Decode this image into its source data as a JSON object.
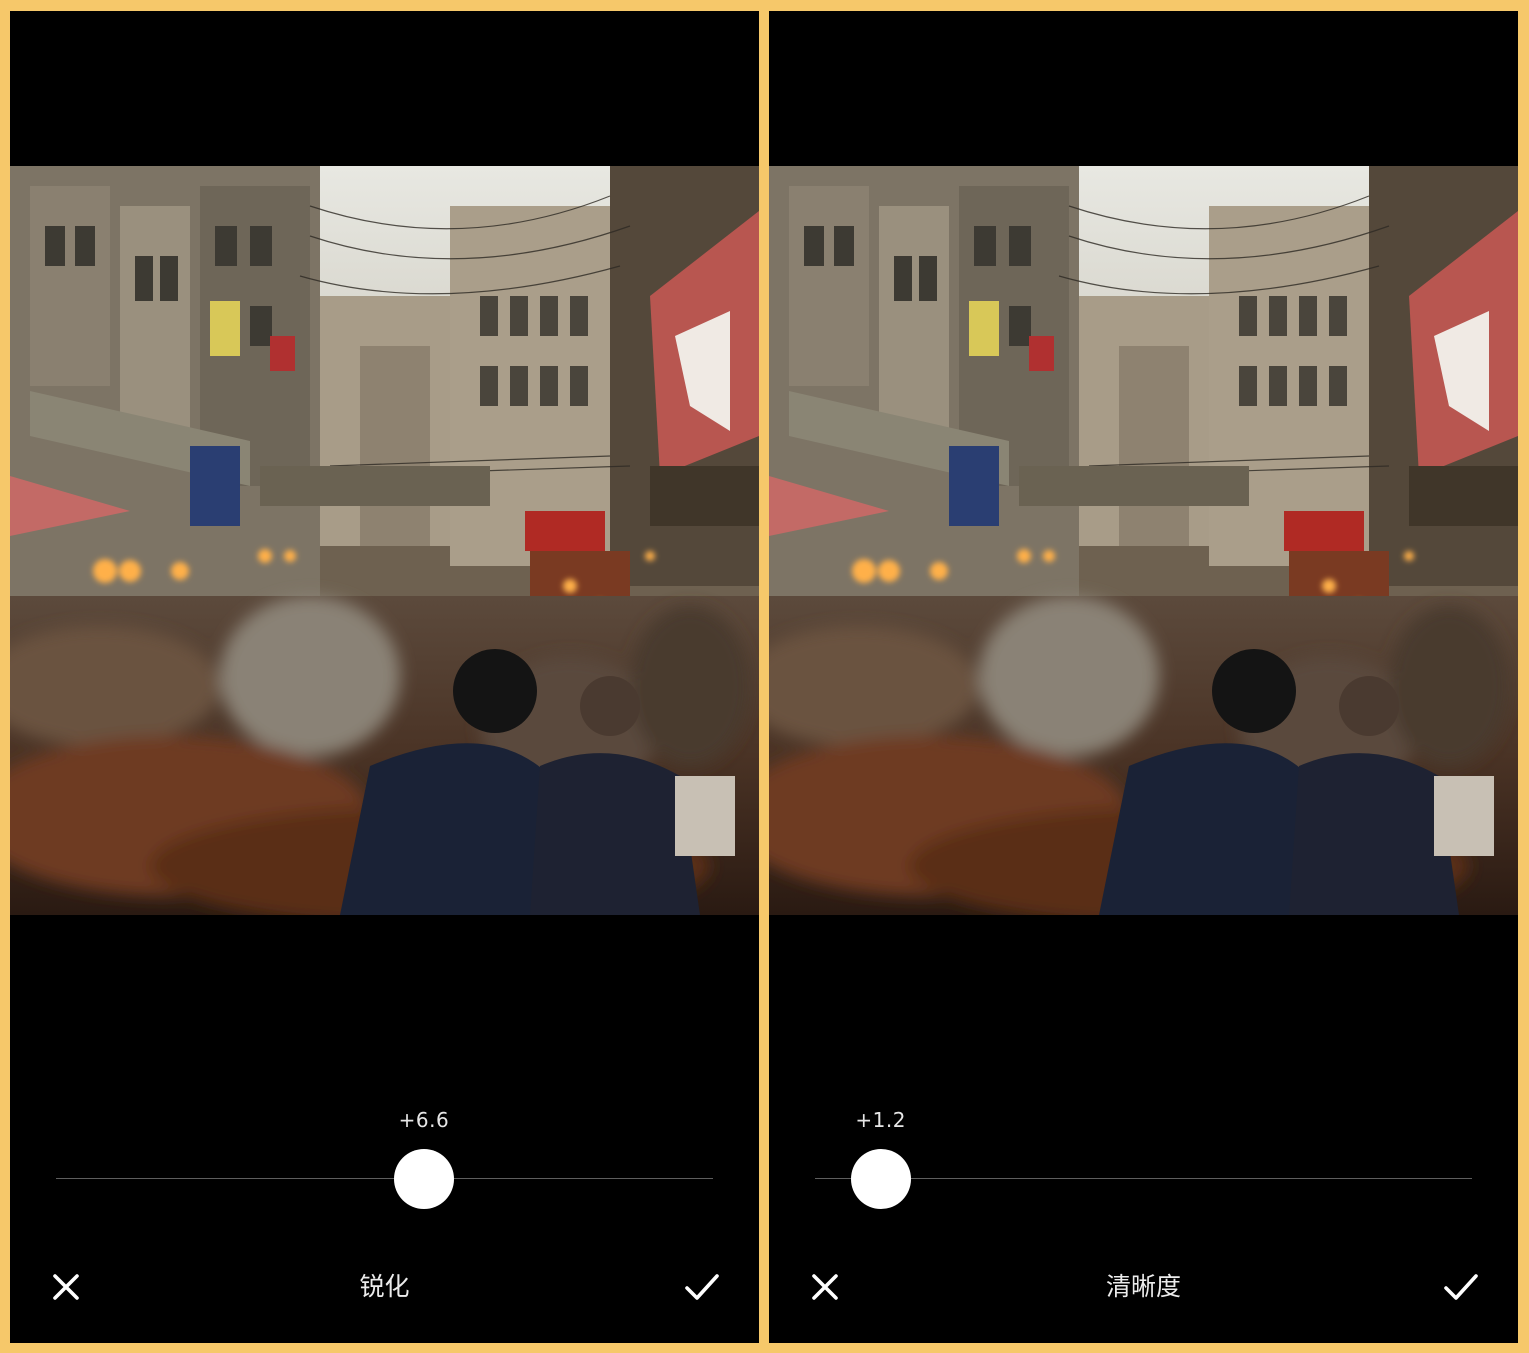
{
  "colors": {
    "border": "#f6c86a",
    "panel_bg": "#000000",
    "thumb": "#ffffff",
    "track": "#5e5e5e"
  },
  "panels": [
    {
      "tool_name": "锐化",
      "value_text": "+6.6",
      "slider_fraction": 0.56,
      "cancel_icon": "close-icon",
      "confirm_icon": "checkmark-icon"
    },
    {
      "tool_name": "清晰度",
      "value_text": "+1.2",
      "slider_fraction": 0.1,
      "cancel_icon": "close-icon",
      "confirm_icon": "checkmark-icon"
    }
  ]
}
